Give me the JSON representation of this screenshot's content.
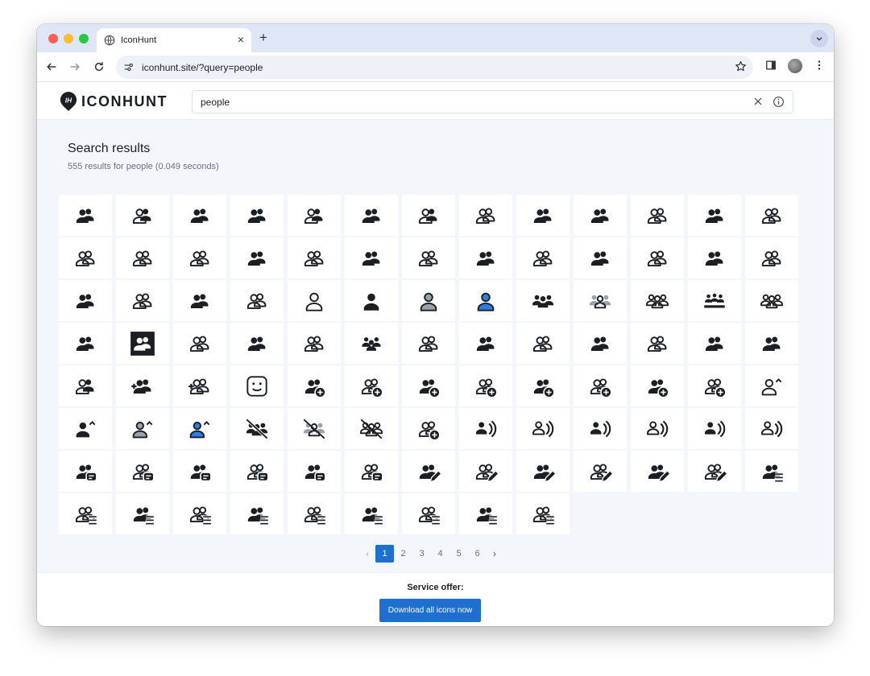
{
  "browser": {
    "tab_title": "IconHunt",
    "tab_close": "×",
    "new_tab": "+",
    "url": "iconhunt.site/?query=people"
  },
  "site": {
    "brand": "ICONHUNT",
    "logo_mark": "IH",
    "search_value": "people"
  },
  "results": {
    "title": "Search results",
    "meta": "555 results for people (0.049 seconds)"
  },
  "icons": [
    "people-solid",
    "people-outline-mixed",
    "people-solid",
    "people-solid",
    "people-outline-mixed",
    "people-solid",
    "people-outline-mixed",
    "people-outline",
    "people-solid",
    "people-solid",
    "people-outline",
    "people-solid",
    "people-outline",
    "people-outline",
    "people-outline",
    "people-outline",
    "people-solid",
    "people-outline",
    "people-solid",
    "people-outline",
    "people-solid",
    "people-outline",
    "people-solid",
    "people-outline",
    "people-solid",
    "people-outline",
    "people-solid",
    "people-outline",
    "people-solid",
    "people-outline",
    "person-outline",
    "person-solid",
    "person-gray",
    "person-blue",
    "group-three-solid",
    "group-three-gray",
    "group-three-outline",
    "meeting-solid",
    "group-three-outline",
    "people-solid",
    "people-box",
    "people-outline",
    "people-solid",
    "people-outline",
    "group-solid",
    "people-outline",
    "people-solid",
    "people-outline",
    "people-solid",
    "people-outline",
    "people-solid",
    "people-solid",
    "people-outline-mixed",
    "people-add-solid",
    "people-add-outline",
    "face-smile",
    "people-plus-solid",
    "people-plus-outline",
    "people-plus-solid",
    "people-plus-outline",
    "people-plus-solid",
    "people-plus-outline",
    "people-plus-solid",
    "people-plus-outline",
    "person-up-outline",
    "person-up-solid",
    "person-up-gray",
    "person-up-blue",
    "people-off-solid",
    "people-off-gray",
    "people-off-outline",
    "people-plus-outline",
    "people-voice-solid",
    "people-voice-outline",
    "people-voice-solid",
    "people-voice-outline",
    "people-voice-solid",
    "people-voice-outline",
    "people-chat-solid",
    "people-chat-outline",
    "people-chat-solid",
    "people-chat-outline",
    "people-chat-solid",
    "people-chat-outline",
    "people-edit-solid",
    "people-edit-outline",
    "people-edit-solid",
    "people-edit-outline",
    "people-edit-solid",
    "people-edit-outline",
    "people-list-solid",
    "people-list-outline",
    "people-list-solid",
    "people-list-outline",
    "people-list-solid",
    "people-list-outline",
    "people-list-solid",
    "people-list-outline",
    "people-list-solid",
    "people-list-outline"
  ],
  "pagination": {
    "prev": "‹",
    "pages": [
      "1",
      "2",
      "3",
      "4",
      "5",
      "6"
    ],
    "active": "1",
    "next": "›"
  },
  "footer": {
    "offer_label": "Service offer:",
    "cta": "Download all icons now"
  },
  "colors": {
    "accent": "#1f6fd1",
    "icon_dark": "#1b1e23",
    "icon_gray": "#9aa1a9",
    "icon_blue": "#2f7de1"
  }
}
